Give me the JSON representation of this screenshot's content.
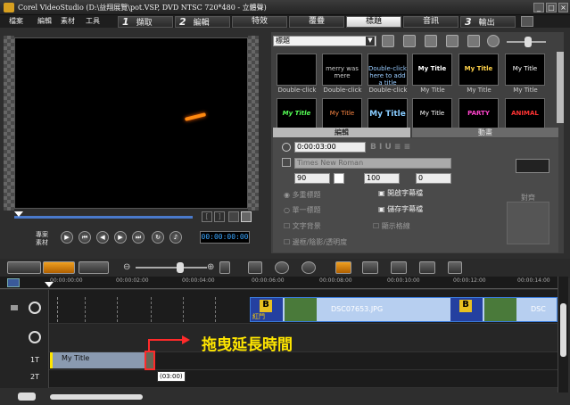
{
  "window": {
    "title": "Corel VideoStudio (D:\\益翔展覽\\pot.VSP, DVD NTSC 720*480 - 立體聲)",
    "min": "_",
    "max": "□",
    "close": "×"
  },
  "menu": [
    "檔案",
    "編輯",
    "素材",
    "工具"
  ],
  "steps": [
    {
      "num": "1",
      "label": "擷取"
    },
    {
      "num": "2",
      "label": "編輯"
    },
    {
      "num": "",
      "label": "特效"
    },
    {
      "num": "",
      "label": "覆疊"
    },
    {
      "num": "",
      "label": "標題"
    },
    {
      "num": "",
      "label": "音訊"
    },
    {
      "num": "3",
      "label": "輸出"
    }
  ],
  "preview": {
    "mode_project": "專案",
    "mode_clip": "素材",
    "timecode": "00:00:00:00"
  },
  "library": {
    "category": "標題",
    "thumbs": [
      {
        "text": "",
        "label": "Double-click"
      },
      {
        "text": "merry was mere",
        "label": "Double-click"
      },
      {
        "text": "Double-click here to add a title",
        "label": "Double-click"
      },
      {
        "text": "My Title",
        "label": "My Title"
      },
      {
        "text": "My Title",
        "label": "My Title"
      },
      {
        "text": "My Title",
        "label": "My Title"
      },
      {
        "text": "My Title",
        "label": ""
      },
      {
        "text": "My Title",
        "label": ""
      },
      {
        "text": "My Title",
        "label": ""
      },
      {
        "text": "My Title",
        "label": ""
      },
      {
        "text": "PARTY",
        "label": ""
      },
      {
        "text": "ANIMAL",
        "label": ""
      }
    ]
  },
  "options": {
    "tab_edit": "編輯",
    "tab_animation": "動畫",
    "duration": "0:00:03:00",
    "font": "Times New Roman",
    "size": "90",
    "line_spacing": "100",
    "angle": "0",
    "multi_title": "多重標題",
    "single_title": "單一標題",
    "text_bg": "文字背景",
    "safe_area": "顯示格線",
    "open_title_file": "開啟字幕檔",
    "save_title_file": "儲存字幕檔",
    "border_shadow": "邊框/陰影/透明度",
    "align": "對齊"
  },
  "ruler": [
    "00:00:00:00",
    "00:00:02:00",
    "00:00:04:00",
    "00:00:06:00",
    "00:00:08:00",
    "00:00:10:00",
    "00:00:12:00",
    "00:00:14:00"
  ],
  "tracks": {
    "title1": "1T",
    "title2": "2T"
  },
  "clips": {
    "video": "DSC07653.JPG",
    "video_trail": "DSC",
    "photo_tag": "紅門",
    "title": "My Title",
    "drag_time": "(03:00)"
  },
  "annotation": "拖曳延長時間",
  "colors": {
    "annotation": "#ffe600",
    "arrow": "#ff2a2a",
    "timecode": "#39a6ff"
  }
}
